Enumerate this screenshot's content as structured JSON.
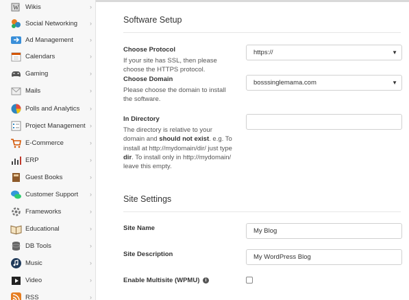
{
  "sidebar": {
    "items": [
      {
        "label": "Wikis",
        "icon": "wiki-icon"
      },
      {
        "label": "Social Networking",
        "icon": "social-networking-icon"
      },
      {
        "label": "Ad Management",
        "icon": "ad-management-icon"
      },
      {
        "label": "Calendars",
        "icon": "calendar-icon"
      },
      {
        "label": "Gaming",
        "icon": "gamepad-icon"
      },
      {
        "label": "Mails",
        "icon": "mail-icon"
      },
      {
        "label": "Polls and Analytics",
        "icon": "pie-chart-icon"
      },
      {
        "label": "Project Management",
        "icon": "project-icon"
      },
      {
        "label": "E-Commerce",
        "icon": "cart-icon"
      },
      {
        "label": "ERP",
        "icon": "erp-icon"
      },
      {
        "label": "Guest Books",
        "icon": "book-icon"
      },
      {
        "label": "Customer Support",
        "icon": "chat-icon"
      },
      {
        "label": "Frameworks",
        "icon": "framework-icon"
      },
      {
        "label": "Educational",
        "icon": "education-icon"
      },
      {
        "label": "DB Tools",
        "icon": "database-icon"
      },
      {
        "label": "Music",
        "icon": "music-icon"
      },
      {
        "label": "Video",
        "icon": "video-icon"
      },
      {
        "label": "RSS",
        "icon": "rss-icon"
      }
    ],
    "chevron": "›"
  },
  "software_setup": {
    "title": "Software Setup",
    "protocol": {
      "label": "Choose Protocol",
      "help": "If your site has SSL, then please choose the HTTPS protocol.",
      "value": "https://"
    },
    "domain": {
      "label": "Choose Domain",
      "help": "Please choose the domain to install the software.",
      "value": "bosssinglemama.com"
    },
    "directory": {
      "label": "In Directory",
      "help_1": "The directory is relative to your domain and ",
      "help_bold_1": "should not exist",
      "help_2": ". e.g. To install at http://mydomain/dir/ just type ",
      "help_bold_2": "dir",
      "help_3": ". To install only in http://mydomain/ leave this empty.",
      "value": ""
    }
  },
  "site_settings": {
    "title": "Site Settings",
    "site_name": {
      "label": "Site Name",
      "value": "My Blog"
    },
    "site_description": {
      "label": "Site Description",
      "value": "My WordPress Blog"
    },
    "multisite": {
      "label": "Enable Multisite (WPMU)",
      "info": "i",
      "checked": false
    }
  },
  "dropdown_arrow": "▼"
}
